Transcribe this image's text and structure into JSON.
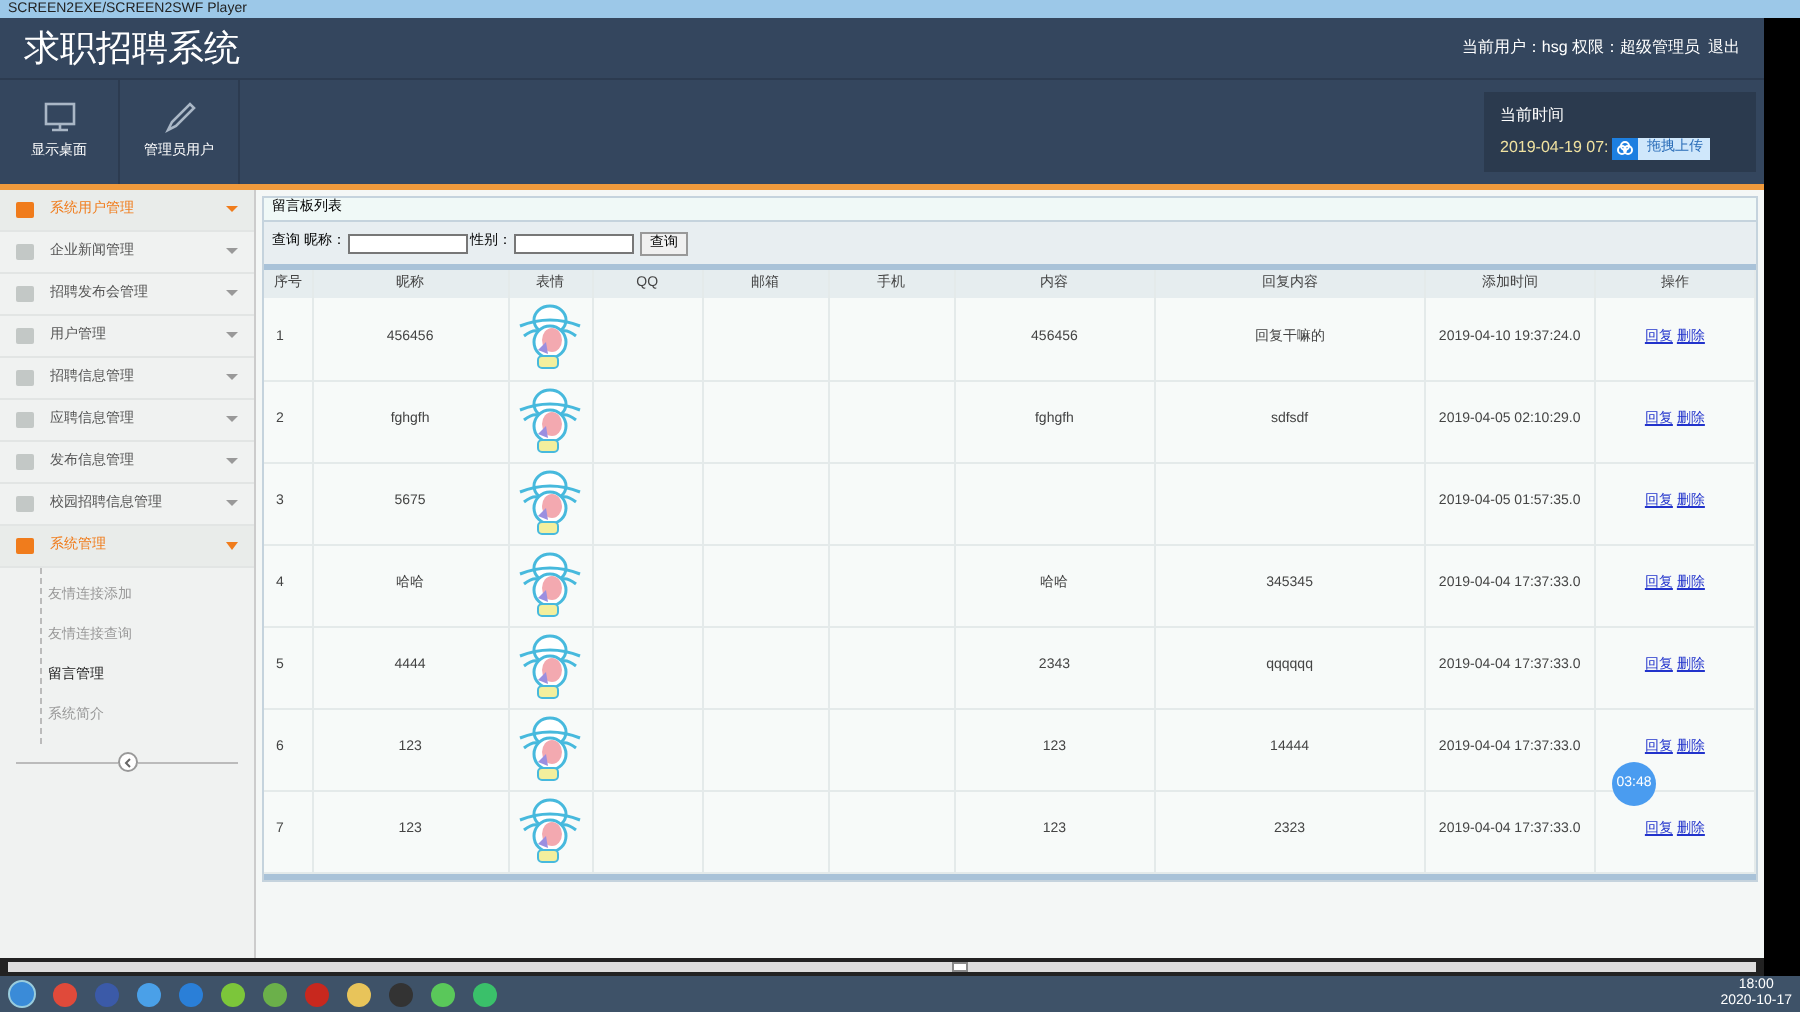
{
  "player": {
    "title": "SCREEN2EXE/SCREEN2SWF Player"
  },
  "header": {
    "title": "求职招聘系统",
    "user_info": "当前用户：hsg  权限：超级管理员",
    "logout": "退出",
    "toolbar": [
      {
        "label": "显示桌面",
        "kind": "monitor"
      },
      {
        "label": "管理员用户",
        "kind": "pencil"
      }
    ],
    "clock": {
      "label": "当前时间",
      "time": "2019-04-19 07:",
      "upload_button": "拖拽上传"
    }
  },
  "sidebar": {
    "items": [
      {
        "label": "系统用户管理",
        "active": true,
        "expanded": false
      },
      {
        "label": "企业新闻管理",
        "active": false,
        "expanded": false
      },
      {
        "label": "招聘发布会管理",
        "active": false,
        "expanded": false
      },
      {
        "label": "用户管理",
        "active": false,
        "expanded": false
      },
      {
        "label": "招聘信息管理",
        "active": false,
        "expanded": false
      },
      {
        "label": "应聘信息管理",
        "active": false,
        "expanded": false
      },
      {
        "label": "发布信息管理",
        "active": false,
        "expanded": false
      },
      {
        "label": "校园招聘信息管理",
        "active": false,
        "expanded": false
      },
      {
        "label": "系统管理",
        "active": true,
        "expanded": true,
        "children": [
          {
            "label": "友情连接添加",
            "selected": false
          },
          {
            "label": "友情连接查询",
            "selected": false
          },
          {
            "label": "留言管理",
            "selected": true
          },
          {
            "label": "系统简介",
            "selected": false
          }
        ]
      }
    ]
  },
  "panel": {
    "title": "留言板列表",
    "search": {
      "label": "查询 昵称：",
      "gender_label": "性别：",
      "button": "查询"
    }
  },
  "table": {
    "columns": [
      {
        "label": "序号",
        "kind": "no"
      },
      {
        "label": "昵称",
        "kind": "nickname"
      },
      {
        "label": "表情",
        "kind": "emoticon"
      },
      {
        "label": "QQ",
        "kind": "qq"
      },
      {
        "label": "邮箱",
        "kind": "email"
      },
      {
        "label": "手机",
        "kind": "phone"
      },
      {
        "label": "内容",
        "kind": "content"
      },
      {
        "label": "回复内容",
        "kind": "reply"
      },
      {
        "label": "添加时间",
        "kind": "time"
      },
      {
        "label": "操作",
        "kind": "actions"
      }
    ],
    "rows": [
      {
        "no": "1",
        "nickname": "456456",
        "content": "456456",
        "reply": "回复干嘛的",
        "time": "2019-04-10 19:37:24.0",
        "actions": [
          "回复",
          "删除"
        ]
      },
      {
        "no": "2",
        "nickname": "fghgfh",
        "content": "fghgfh",
        "reply": "sdfsdf",
        "time": "2019-04-05 02:10:29.0",
        "actions": [
          "回复",
          "删除"
        ]
      },
      {
        "no": "3",
        "nickname": "5675",
        "time": "2019-04-05 01:57:35.0",
        "actions": [
          "回复",
          "删除"
        ]
      },
      {
        "no": "4",
        "nickname": "哈哈",
        "content": "哈哈",
        "reply": "345345",
        "time": "2019-04-04 17:37:33.0",
        "actions": [
          "回复",
          "删除"
        ]
      },
      {
        "no": "5",
        "nickname": "4444",
        "content": "2343",
        "reply": "qqqqqq",
        "time": "2019-04-04 17:37:33.0",
        "actions": [
          "回复",
          "删除"
        ]
      },
      {
        "no": "6",
        "nickname": "123",
        "content": "123",
        "reply": "14444",
        "time": "2019-04-04 17:37:33.0",
        "actions": [
          "回复",
          "删除"
        ]
      },
      {
        "no": "7",
        "nickname": "123",
        "content": "123",
        "reply": "2323",
        "time": "2019-04-04 17:37:33.0",
        "actions": [
          "回复",
          "删除"
        ]
      }
    ]
  },
  "timer_badge": "03:48",
  "taskbar": {
    "time": "18:00",
    "date": "2020-10-17"
  }
}
